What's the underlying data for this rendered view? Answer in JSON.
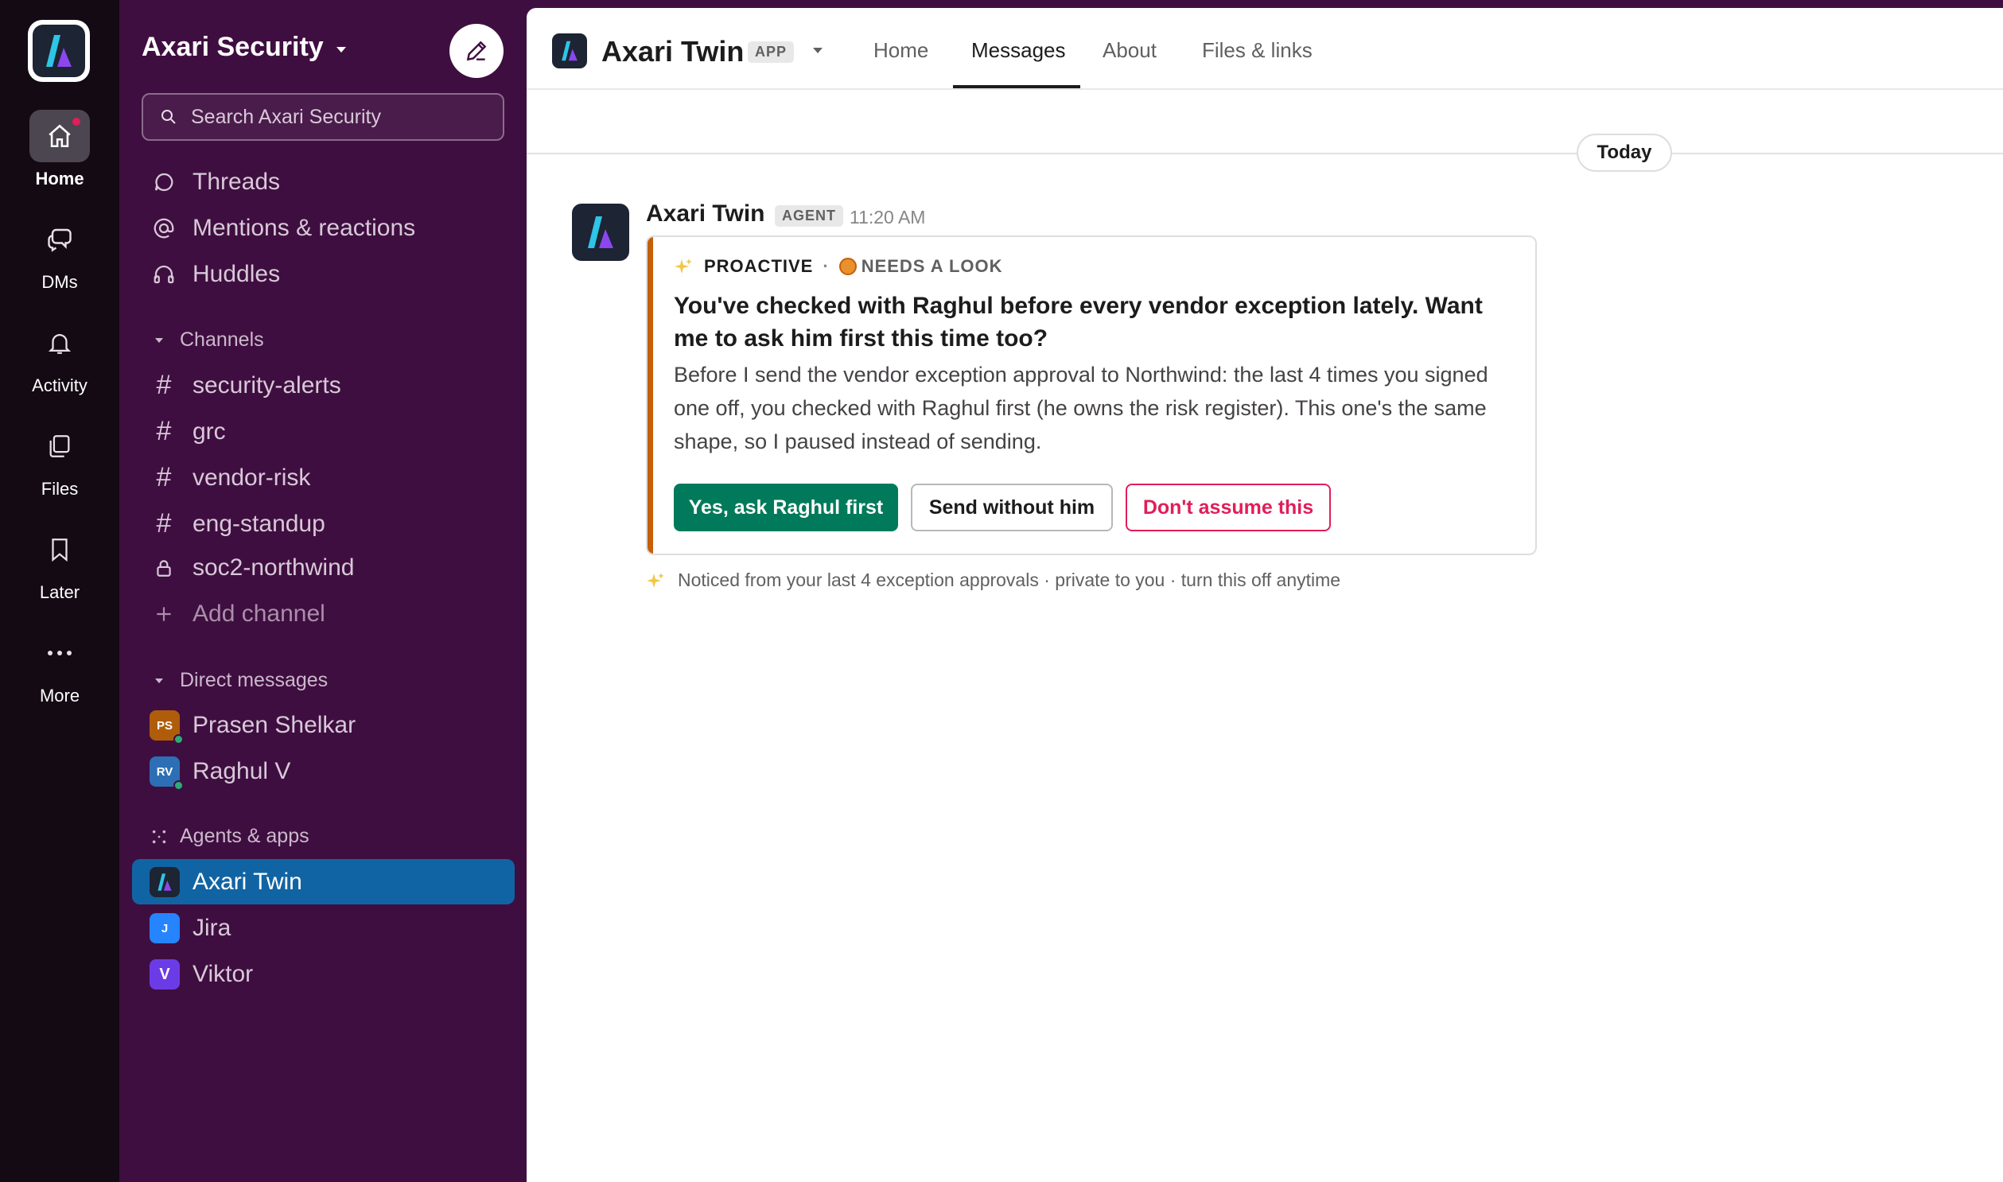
{
  "colors": {
    "rail_bg": "#140a14",
    "sidebar_bg": "#3f0e40",
    "selected": "#1164a3",
    "primary_green": "#007a5a",
    "danger": "#e01e5a",
    "card_accent": "#c45f0a"
  },
  "rail": {
    "items": [
      {
        "label": "Home",
        "icon": "home-icon"
      },
      {
        "label": "DMs",
        "icon": "dms-icon"
      },
      {
        "label": "Activity",
        "icon": "bell-icon"
      },
      {
        "label": "Files",
        "icon": "files-icon"
      },
      {
        "label": "Later",
        "icon": "bookmark-icon"
      },
      {
        "label": "More",
        "icon": "more-icon"
      }
    ]
  },
  "sidebar": {
    "workspace_name": "Axari Security",
    "search_placeholder": "Search Axari Security",
    "nav": [
      {
        "label": "Threads",
        "icon": "threads-icon"
      },
      {
        "label": "Mentions & reactions",
        "icon": "at-icon"
      },
      {
        "label": "Huddles",
        "icon": "headphones-icon"
      }
    ],
    "channels_heading": "Channels",
    "channels": [
      {
        "label": "security-alerts",
        "icon": "hash"
      },
      {
        "label": "grc",
        "icon": "hash"
      },
      {
        "label": "vendor-risk",
        "icon": "hash"
      },
      {
        "label": "eng-standup",
        "icon": "hash"
      },
      {
        "label": "soc2-northwind",
        "icon": "lock-icon"
      }
    ],
    "add_channel": "Add channel",
    "dm_heading": "Direct messages",
    "dms": [
      {
        "label": "Prasen Shelkar",
        "initials": "PS",
        "color": "#b05d0b",
        "presence": "#2bac76"
      },
      {
        "label": "Raghul V",
        "initials": "RV",
        "color": "#2d6fb5",
        "presence": "#2bac76"
      }
    ],
    "apps_heading": "Agents & apps",
    "apps": [
      {
        "label": "Axari Twin"
      },
      {
        "label": "Jira",
        "initials": "J",
        "color": "#2684ff"
      },
      {
        "label": "Viktor",
        "initials": "V",
        "color": "#6b3ce6"
      }
    ]
  },
  "header": {
    "title": "Axari Twin",
    "badge": "APP",
    "tabs": [
      "Home",
      "Messages",
      "About",
      "Files & links"
    ],
    "active_tab": "Messages"
  },
  "conversation": {
    "day_divider": "Today",
    "message": {
      "sender": "Axari Twin",
      "badge": "AGENT",
      "time": "11:20 AM",
      "card": {
        "tag": "PROACTIVE",
        "separator": "·",
        "status": "NEEDS A LOOK",
        "title": "You've checked with Raghul before every vendor exception lately. Want me to ask him first this time too?",
        "body": "Before I send the vendor exception approval to Northwind: the last 4 times you signed one off, you checked with Raghul first (he owns the risk register). This one's the same shape, so I paused instead of sending.",
        "actions": {
          "primary": "Yes, ask Raghul first",
          "secondary": "Send without him",
          "danger": "Don't assume this"
        }
      },
      "footnote": "Noticed from your last 4 exception approvals · private to you · turn this off anytime"
    }
  }
}
